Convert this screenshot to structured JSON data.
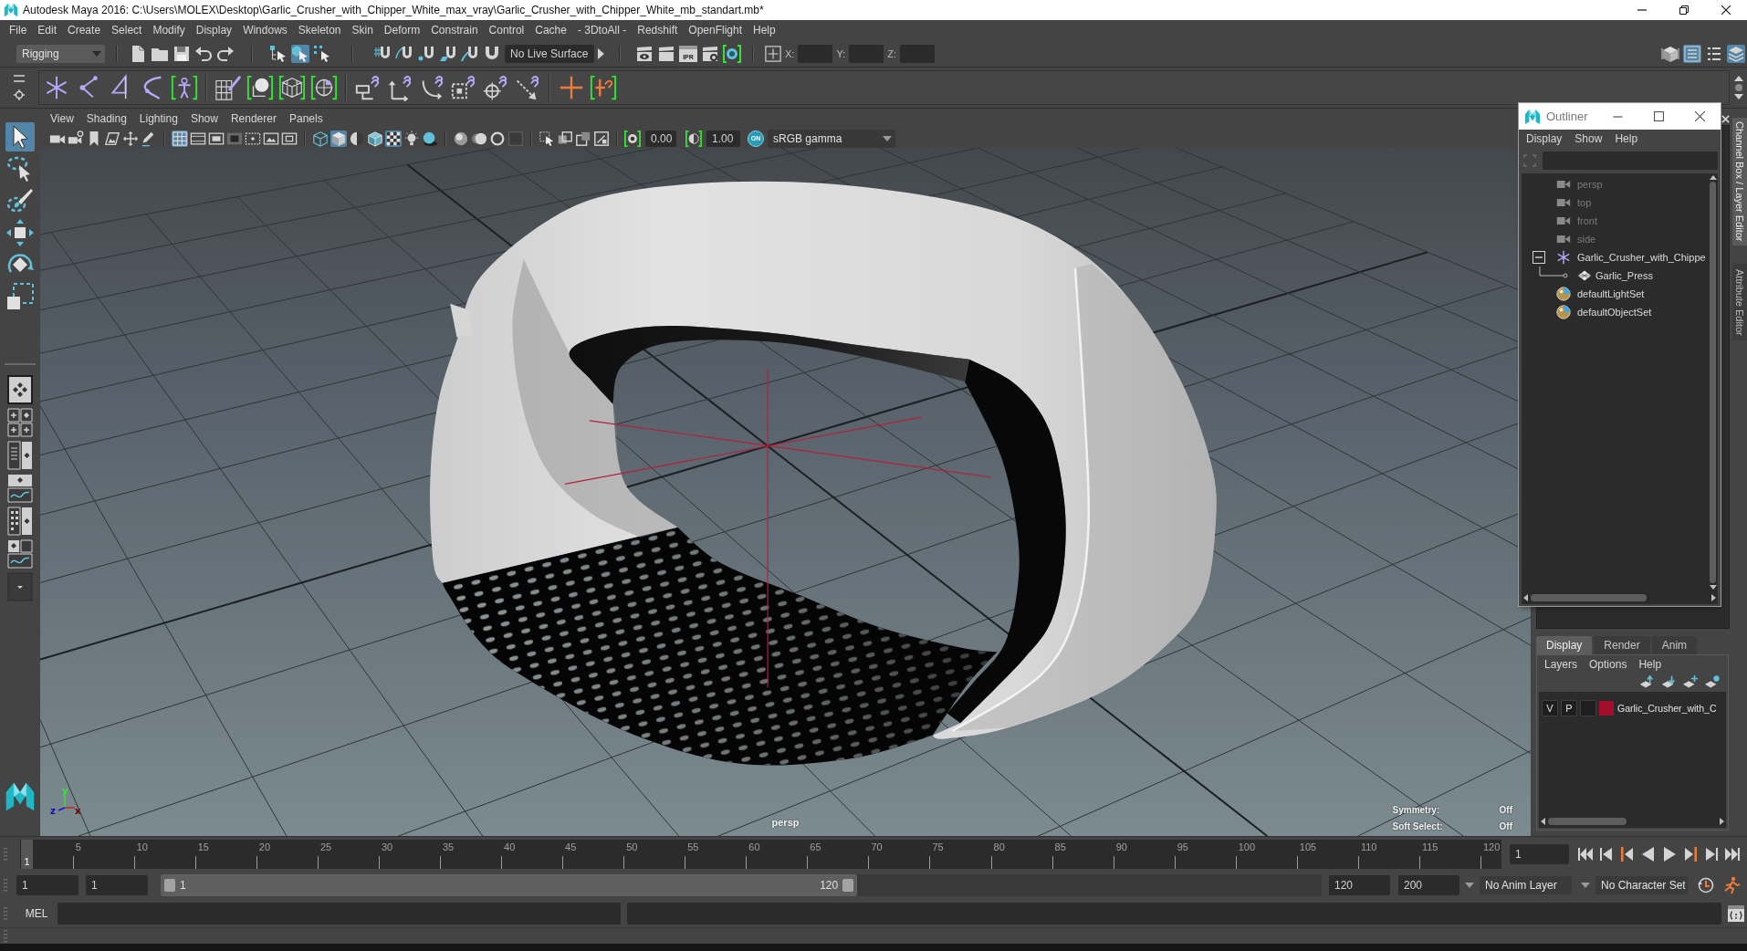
{
  "window": {
    "title": "Autodesk Maya 2016: C:\\Users\\MOLEX\\Desktop\\Garlic_Crusher_with_Chipper_White_max_vray\\Garlic_Crusher_with_Chipper_White_mb_standart.mb*"
  },
  "menu_bar": [
    "File",
    "Edit",
    "Create",
    "Select",
    "Modify",
    "Display",
    "Windows",
    "Skeleton",
    "Skin",
    "Deform",
    "Constrain",
    "Control",
    "Cache",
    "- 3DtoAll -",
    "Redshift",
    "OpenFlight",
    "Help"
  ],
  "status_line": {
    "menu_set": "Rigging",
    "selection_modes": [
      {
        "kind": "hierarchy",
        "selected": false
      },
      {
        "kind": "object",
        "selected": true
      },
      {
        "kind": "component",
        "selected": false
      }
    ],
    "live_surface": "No Live Surface",
    "ipr_label": "IPR",
    "coordinates": [
      {
        "label": "X:"
      },
      {
        "label": "Y:"
      },
      {
        "label": "Z:"
      }
    ],
    "panel_toggles": [
      {
        "kind": "modeling-toolkit",
        "selected": false
      },
      {
        "kind": "attribute-editor",
        "selected": true
      },
      {
        "kind": "tool-settings",
        "selected": false
      },
      {
        "kind": "channel-box",
        "selected": true
      }
    ]
  },
  "toolbox": {
    "tools": [
      {
        "kind": "select",
        "selected": true
      },
      {
        "kind": "lasso",
        "selected": false
      },
      {
        "kind": "paint",
        "selected": false
      },
      {
        "kind": "move",
        "selected": false
      },
      {
        "kind": "rotate",
        "selected": false
      },
      {
        "kind": "scale",
        "selected": false
      }
    ]
  },
  "viewport": {
    "menu": [
      "View",
      "Shading",
      "Lighting",
      "Show",
      "Renderer",
      "Panels"
    ],
    "toolbar": [
      [
        {
          "kind": "camera",
          "selected": false
        },
        {
          "kind": "camera-attributes",
          "selected": false
        },
        {
          "kind": "bookmark",
          "selected": false
        },
        {
          "kind": "image-plane",
          "selected": false
        },
        {
          "kind": "pan-zoom",
          "selected": false
        },
        {
          "kind": "grease-pencil",
          "selected": false
        }
      ],
      [
        {
          "kind": "grid",
          "selected": true
        },
        {
          "kind": "film-gate",
          "selected": false
        },
        {
          "kind": "resolution-gate",
          "selected": false
        },
        {
          "kind": "gate-mask",
          "selected": false
        },
        {
          "kind": "field-chart",
          "selected": false
        },
        {
          "kind": "safe-action",
          "selected": false
        },
        {
          "kind": "safe-title",
          "selected": false
        }
      ],
      [
        {
          "kind": "wireframe",
          "selected": false
        },
        {
          "kind": "smooth-shade",
          "selected": true
        },
        {
          "kind": "default-material",
          "selected": false
        },
        {
          "kind": "wireframe-on-shaded",
          "selected": false
        },
        {
          "kind": "textured",
          "selected": true
        },
        {
          "kind": "lights",
          "selected": false
        },
        {
          "kind": "shadows",
          "selected": false
        }
      ],
      [
        {
          "kind": "ambient-occlusion",
          "selected": false
        },
        {
          "kind": "motion-blur",
          "selected": false
        },
        {
          "kind": "anti-aliasing",
          "selected": false
        },
        {
          "kind": "depth-of-field",
          "selected": false
        }
      ],
      [
        {
          "kind": "isolate",
          "selected": false
        },
        {
          "kind": "xray",
          "selected": false
        },
        {
          "kind": "xray-joints",
          "selected": false
        },
        {
          "kind": "xray-components",
          "selected": false
        }
      ]
    ],
    "exposure": "0.00",
    "gamma": "1.00",
    "color_management": "ON",
    "color_space": "sRGB gamma",
    "camera": "persp",
    "axis_labels": [
      "y",
      "z",
      "x"
    ],
    "hud": [
      {
        "label": "Symmetry:",
        "value": "Off"
      },
      {
        "label": "Soft Select:",
        "value": "Off"
      }
    ]
  },
  "outliner": {
    "title": "Outliner",
    "menu": [
      "Display",
      "Show",
      "Help"
    ],
    "items": [
      {
        "label": "persp",
        "kind": "camera",
        "hidden": true
      },
      {
        "label": "top",
        "kind": "camera",
        "hidden": true
      },
      {
        "label": "front",
        "kind": "camera",
        "hidden": true
      },
      {
        "label": "side",
        "kind": "camera",
        "hidden": true
      },
      {
        "label": "Garlic_Crusher_with_Chippe",
        "kind": "group",
        "hidden": false,
        "expanded": true,
        "children": [
          {
            "label": "Garlic_Press",
            "kind": "mesh",
            "hidden": false
          }
        ]
      },
      {
        "label": "defaultLightSet",
        "kind": "set",
        "hidden": false
      },
      {
        "label": "defaultObjectSet",
        "kind": "set",
        "hidden": false
      }
    ]
  },
  "side_tabs": [
    {
      "label": "Channel Box / Layer Editor",
      "selected": true
    },
    {
      "label": "Attribute Editor",
      "selected": false
    }
  ],
  "layer_editor": {
    "tabs": [
      {
        "label": "Display",
        "selected": true
      },
      {
        "label": "Render",
        "selected": false
      },
      {
        "label": "Anim",
        "selected": false
      }
    ],
    "menu": [
      "Layers",
      "Options",
      "Help"
    ],
    "layers": [
      {
        "visibility": "V",
        "playback": "P",
        "name": "Garlic_Crusher_with_C",
        "color": "#a50d2d"
      }
    ]
  },
  "time_slider": {
    "current_frame": "1",
    "level": 0,
    "ticks": [
      "5",
      "10",
      "15",
      "20",
      "25",
      "30",
      "35",
      "40",
      "45",
      "50",
      "55",
      "60",
      "65",
      "70",
      "75",
      "80",
      "85",
      "90",
      "95",
      "100",
      "105",
      "110",
      "115",
      "120"
    ],
    "frame_field": "1"
  },
  "range_slider": {
    "start_field": "1",
    "playback_start_field": "1",
    "range_start": "1",
    "range_end": "120",
    "level": 0.6,
    "playback_end_field": "120",
    "end_field": "200",
    "anim_layer": "No Anim Layer",
    "character_set": "No Character Set"
  },
  "command_line": {
    "language": "MEL"
  }
}
